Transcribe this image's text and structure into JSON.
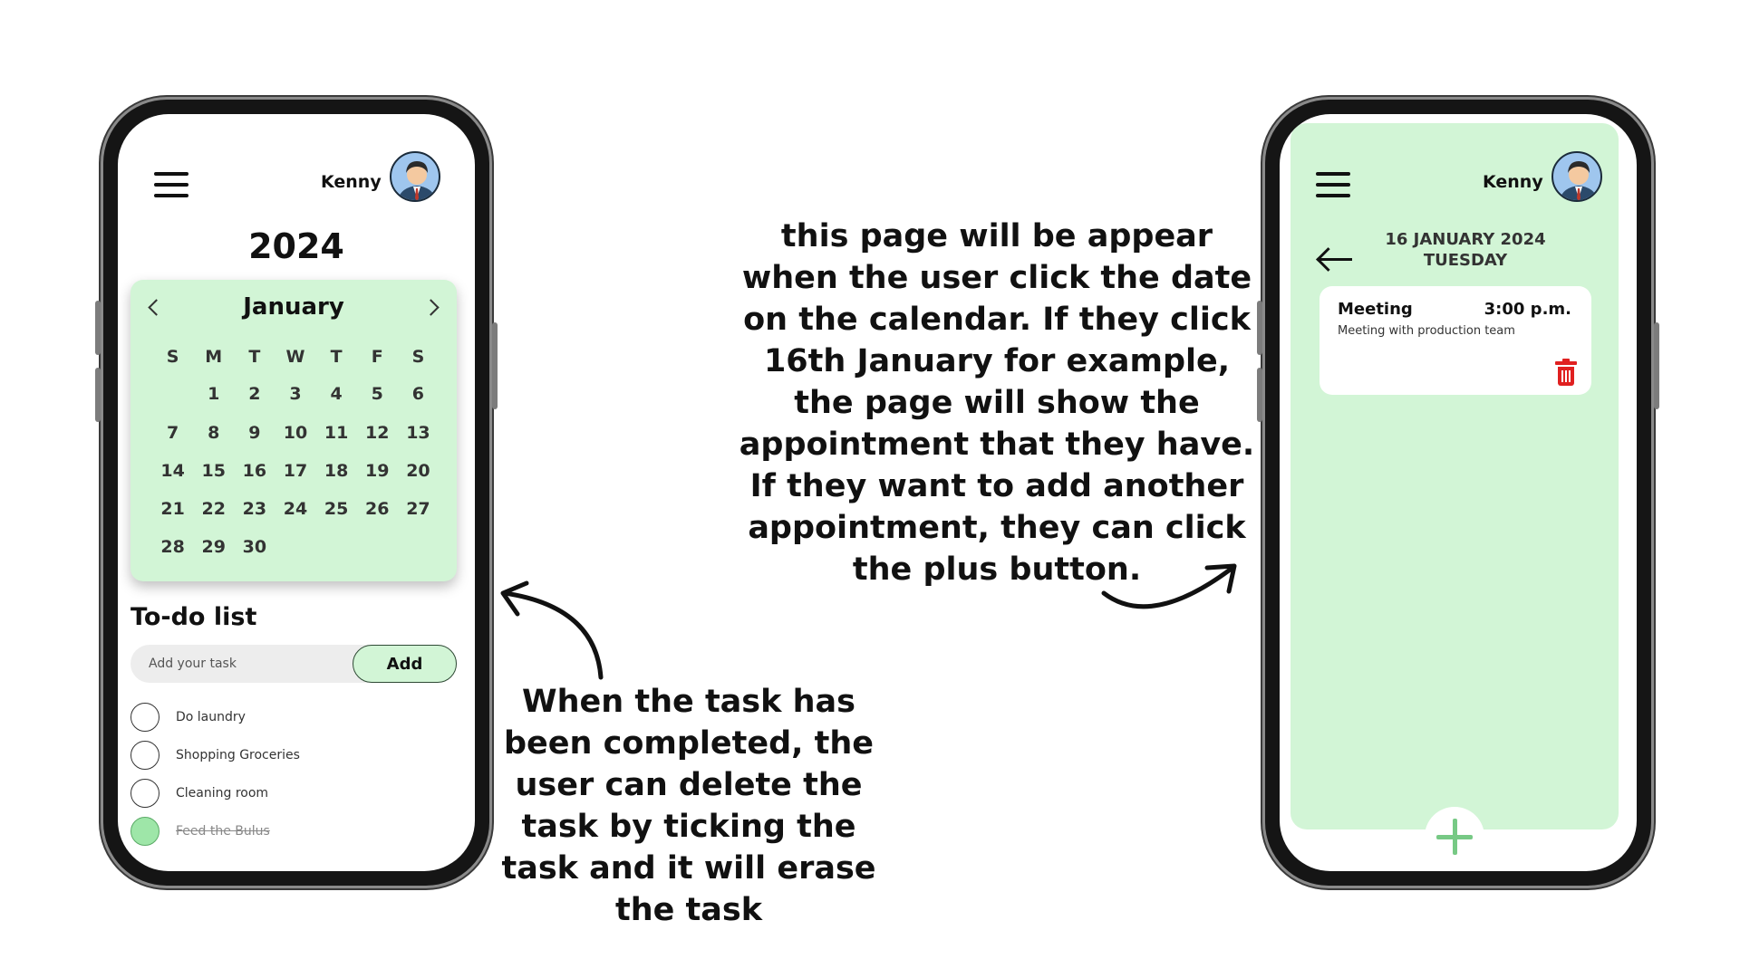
{
  "left_screen": {
    "user_name": "Kenny",
    "year": "2024",
    "calendar": {
      "month": "January",
      "weekdays": [
        "S",
        "M",
        "T",
        "W",
        "T",
        "F",
        "S"
      ],
      "weeks": [
        [
          "",
          "1",
          "2",
          "3",
          "4",
          "5",
          "6"
        ],
        [
          "7",
          "8",
          "9",
          "10",
          "11",
          "12",
          "13"
        ],
        [
          "14",
          "15",
          "16",
          "17",
          "18",
          "19",
          "20"
        ],
        [
          "21",
          "22",
          "23",
          "24",
          "25",
          "26",
          "27"
        ],
        [
          "28",
          "29",
          "30",
          "",
          "",
          "",
          ""
        ]
      ]
    },
    "todo": {
      "title": "To-do list",
      "input_placeholder": "Add your task",
      "add_label": "Add",
      "items": [
        {
          "label": "Do laundry",
          "done": false
        },
        {
          "label": "Shopping Groceries",
          "done": false
        },
        {
          "label": "Cleaning room",
          "done": false
        },
        {
          "label": "Feed the Bulus",
          "done": true
        }
      ]
    }
  },
  "right_screen": {
    "user_name": "Kenny",
    "date_line": "16 JANUARY 2024",
    "day_line": "TUESDAY",
    "appointment": {
      "title": "Meeting",
      "time": "3:00 p.m.",
      "description": "Meeting with production team"
    }
  },
  "annotations": {
    "right_note": "this page will be appear when the user click the date on the calendar. If they click 16th January for example, the page will show the appointment that they have. If they want to add another appointment, they can click the plus button.",
    "left_note": "When the task has been completed, the user can delete the task by ticking the task and it will erase the task"
  },
  "colors": {
    "accent_green": "#d2f5d6",
    "plus_green": "#77c985",
    "done_check": "#9ee6a8",
    "delete_red": "#e02020"
  },
  "icons": [
    "menu-icon",
    "avatar",
    "chevron-left-icon",
    "chevron-right-icon",
    "back-arrow-icon",
    "trash-icon",
    "plus-icon"
  ]
}
